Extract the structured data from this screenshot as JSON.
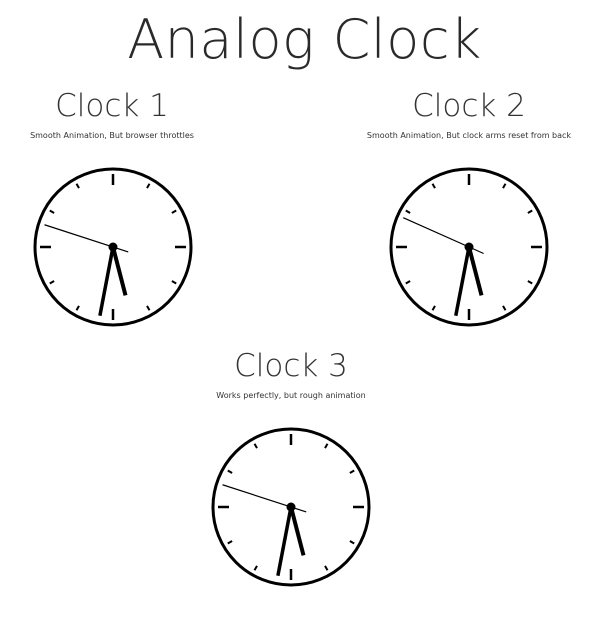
{
  "page": {
    "title": "Analog Clock"
  },
  "clocks": [
    {
      "title": "Clock 1",
      "description": "Smooth Animation, But browser throttles",
      "time": {
        "hour": 5,
        "minute": 31,
        "second": 48
      }
    },
    {
      "title": "Clock 2",
      "description": "Smooth Animation, But clock arms reset from back",
      "time": {
        "hour": 5,
        "minute": 31,
        "second": 49
      }
    },
    {
      "title": "Clock 3",
      "description": "Works perfectly, but rough animation",
      "time": {
        "hour": 5,
        "minute": 31,
        "second": 48
      }
    }
  ],
  "colors": {
    "ink": "#000000",
    "face": "#ffffff"
  }
}
